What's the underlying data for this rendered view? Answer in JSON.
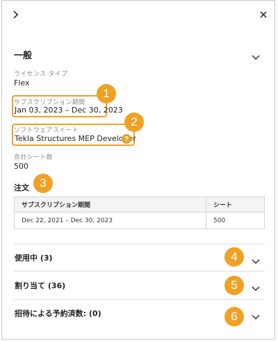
{
  "panel": {
    "section_title": "一般",
    "license_type": {
      "label": "ライセンス タイプ",
      "value": "Flex"
    },
    "subscription_period": {
      "label": "サブスクリプション期間",
      "value": "Jan 03, 2023 – Dec 30, 2023"
    },
    "software_suite": {
      "label": "ソフトウェアスイート",
      "value": "Tekla Structures MEP Developer",
      "help": "?"
    },
    "total_seats": {
      "label": "合計シート数",
      "value": "500"
    }
  },
  "orders": {
    "title": "注文",
    "columns": [
      "サブスクリプション期間",
      "シート"
    ],
    "rows": [
      [
        "Dec 22, 2021 – Dec 30, 2023",
        "500"
      ]
    ]
  },
  "accordions": [
    {
      "label": "使用中 (3)"
    },
    {
      "label": "割り当て (36)"
    },
    {
      "label": "招待による予約済数: (0)"
    }
  ],
  "callouts": [
    "1",
    "2",
    "3",
    "4",
    "5",
    "6"
  ],
  "colors": {
    "callout": "#f0a125",
    "highlight_border": "#f0a02a"
  },
  "icons": {
    "top_left": "chevron-right-icon",
    "top_right": "close-icon",
    "accordion": "chevron-down-icon"
  }
}
